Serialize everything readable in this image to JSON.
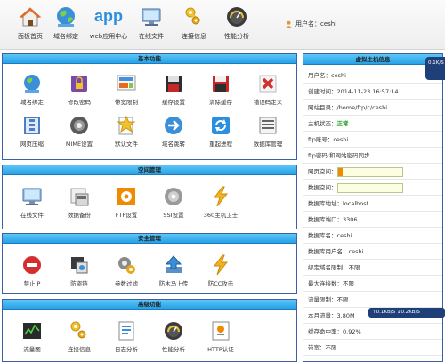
{
  "toolbar": {
    "items": [
      {
        "label": "面板首页",
        "icon": "home-icon"
      },
      {
        "label": "域名绑定",
        "icon": "globe-icon"
      },
      {
        "label": "web应用中心",
        "icon": "app-logo-icon"
      },
      {
        "label": "在线文件",
        "icon": "monitor-icon"
      },
      {
        "label": "连接信息",
        "icon": "keys-icon"
      },
      {
        "label": "性能分析",
        "icon": "gauge-icon"
      }
    ],
    "user_label": "用户名：ceshi",
    "app_logo_text": "app"
  },
  "panels": {
    "basic": {
      "title": "基本功能",
      "items": [
        {
          "label": "域名绑定",
          "icon": "globe-icon"
        },
        {
          "label": "修改密码",
          "icon": "lock-icon"
        },
        {
          "label": "带宽限制",
          "icon": "bandwidth-icon"
        },
        {
          "label": "缓存设置",
          "icon": "save-disk-icon"
        },
        {
          "label": "清除缓存",
          "icon": "clear-disk-icon"
        },
        {
          "label": "错误码定义",
          "icon": "error-x-icon"
        },
        {
          "label": "网页压缩",
          "icon": "compress-icon"
        },
        {
          "label": "MIME设置",
          "icon": "mime-gear-icon"
        },
        {
          "label": "默认文件",
          "icon": "star-file-icon"
        },
        {
          "label": "域名跳转",
          "icon": "redirect-icon"
        },
        {
          "label": "重起进程",
          "icon": "restart-icon"
        },
        {
          "label": "数据库管理",
          "icon": "database-icon"
        }
      ]
    },
    "space": {
      "title": "空间管理",
      "items": [
        {
          "label": "在线文件",
          "icon": "monitor-icon"
        },
        {
          "label": "数据备份",
          "icon": "backup-icon"
        },
        {
          "label": "FTP设置",
          "icon": "ftp-gear-icon"
        },
        {
          "label": "SSI设置",
          "icon": "ssi-gear-icon"
        },
        {
          "label": "360主机卫士",
          "icon": "lightning-icon"
        }
      ]
    },
    "security": {
      "title": "安全管理",
      "items": [
        {
          "label": "禁止IP",
          "icon": "forbid-icon"
        },
        {
          "label": "防盗链",
          "icon": "antileech-icon"
        },
        {
          "label": "参数过滤",
          "icon": "filter-gear-icon"
        },
        {
          "label": "防木马上传",
          "icon": "upload-arrow-icon"
        },
        {
          "label": "防CC攻击",
          "icon": "lightning-icon"
        }
      ]
    },
    "advanced": {
      "title": "高级功能",
      "items": [
        {
          "label": "流量图",
          "icon": "traffic-chart-icon"
        },
        {
          "label": "连接信息",
          "icon": "keys-icon"
        },
        {
          "label": "日志分析",
          "icon": "log-icon"
        },
        {
          "label": "性能分析",
          "icon": "gauge-icon"
        },
        {
          "label": "HTTP认证",
          "icon": "http-auth-icon"
        }
      ]
    }
  },
  "info": {
    "title": "虚拟主机信息",
    "rows": [
      "用户名：ceshi",
      "创建时间：2014-11-23 16:57:14",
      "网站目录：/home/ftp/c/ceshi",
      "主机状态：",
      "ftp账号：ceshi",
      "ftp密码:和网站密码同步",
      "网页空间：",
      "数据空间：",
      "数据库地址：localhost",
      "数据库端口：3306",
      "数据库名：ceshi",
      "数据库用户名：ceshi",
      "绑定域名限制：不限",
      "最大连接数：不限",
      "流量限制：不限",
      "本月流量：3.80M",
      "缓存命中率：0.92%",
      "带宽：不限"
    ],
    "status_value": "正常",
    "web_space_usage_percent": 7,
    "data_space_usage_percent": 0
  },
  "speed": {
    "side": "0.1K/S",
    "up": "0.1KB/S",
    "down": "0.2KB/S"
  }
}
